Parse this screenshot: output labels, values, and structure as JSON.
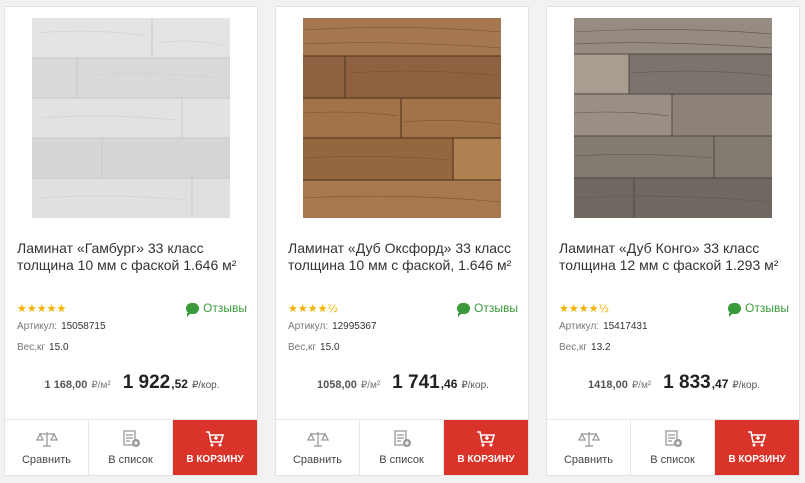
{
  "products": [
    {
      "title": "Ламинат «Гамбург» 33 класс толщина 10 мм с фаской 1.646 м²",
      "stars": "★★★★★",
      "rating_fraction": 1.0,
      "reviews_label": "Отзывы",
      "sku_label": "Артикул:",
      "sku": "15058715",
      "weight_label": "Вес,кг",
      "weight": "15.0",
      "old_price": "1 168,00",
      "old_unit": "₽/м²",
      "price_int": "1 922",
      "price_dec": ",52",
      "price_unit": "₽/кор.",
      "compare_label": "Сравнить",
      "list_label": "В список",
      "cart_label": "В КОРЗИНУ",
      "image_icon": "laminate-gray-white",
      "image_color": "#dedede"
    },
    {
      "title": "Ламинат «Дуб Оксфорд» 33 класс толщина 10 мм с фаской, 1.646 м²",
      "stars": "★★★★½",
      "rating_fraction": 0.9,
      "reviews_label": "Отзывы",
      "sku_label": "Артикул:",
      "sku": "12995367",
      "weight_label": "Вес,кг",
      "weight": "15.0",
      "old_price": "1058,00",
      "old_unit": "₽/м²",
      "price_int": "1 741",
      "price_dec": ",46",
      "price_unit": "₽/кор.",
      "compare_label": "Сравнить",
      "list_label": "В список",
      "cart_label": "В КОРЗИНУ",
      "image_icon": "laminate-oak-brown",
      "image_color": "#9a6c44"
    },
    {
      "title": "Ламинат «Дуб Конго» 33 класс толщина 12 мм с фаской 1.293 м²",
      "stars": "★★★★½",
      "rating_fraction": 0.9,
      "reviews_label": "Отзывы",
      "sku_label": "Артикул:",
      "sku": "15417431",
      "weight_label": "Вес,кг",
      "weight": "13.2",
      "old_price": "1418,00",
      "old_unit": "₽/м²",
      "price_int": "1 833",
      "price_dec": ",47",
      "price_unit": "₽/кор.",
      "compare_label": "Сравнить",
      "list_label": "В список",
      "cart_label": "В КОРЗИНУ",
      "image_icon": "laminate-oak-gray",
      "image_color": "#8a8178"
    }
  ],
  "colors": {
    "accent_red": "#d9332a",
    "review_green": "#3a9a3a",
    "star_gold": "#f2b200"
  }
}
